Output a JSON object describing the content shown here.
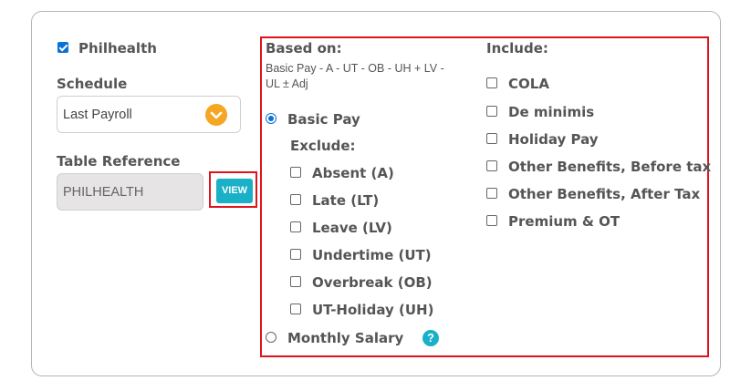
{
  "philhealth": {
    "label": "Philhealth",
    "checked": true
  },
  "schedule": {
    "label": "Schedule",
    "value": "Last Payroll",
    "dropdown_icon": "chevron-down-icon"
  },
  "table_reference": {
    "label": "Table Reference",
    "value": "PHILHEALTH",
    "view_label": "VIEW"
  },
  "based_on": {
    "heading": "Based on:",
    "formula_line1": "Basic Pay - A - UT - OB - UH + LV -",
    "formula_line2": "UL ± Adj",
    "basic_pay": {
      "label": "Basic Pay",
      "selected": true
    },
    "exclude_heading": "Exclude:",
    "exclude": [
      {
        "label": "Absent (A)",
        "checked": false
      },
      {
        "label": "Late (LT)",
        "checked": false
      },
      {
        "label": "Leave (LV)",
        "checked": false
      },
      {
        "label": "Undertime (UT)",
        "checked": false
      },
      {
        "label": "Overbreak (OB)",
        "checked": false
      },
      {
        "label": "UT-Holiday (UH)",
        "checked": false
      }
    ],
    "monthly_salary": {
      "label": "Monthly Salary",
      "selected": false
    },
    "help_icon": "question-icon",
    "help_glyph": "?"
  },
  "include": {
    "heading": "Include:",
    "items": [
      {
        "label": "COLA",
        "checked": false
      },
      {
        "label": "De minimis",
        "checked": false
      },
      {
        "label": "Holiday Pay",
        "checked": false
      },
      {
        "label": "Other Benefits, Before tax",
        "checked": false
      },
      {
        "label": "Other Benefits, After Tax",
        "checked": false
      },
      {
        "label": "Premium & OT",
        "checked": false
      }
    ]
  },
  "colors": {
    "accent": "#0b6fd6",
    "highlight": "#e0131b",
    "teal": "#1ab0c8",
    "orange": "#f5a623"
  }
}
